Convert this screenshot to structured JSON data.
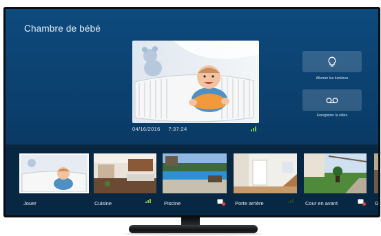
{
  "screen": {
    "room_title": "Chambre de bébé",
    "timestamp_date": "04/16/2016",
    "timestamp_time": "7:37:24",
    "actions": [
      {
        "label": "Allumer les lumières",
        "icon": "lightbulb-icon"
      },
      {
        "label": "Enregistrer la vidéo",
        "icon": "voicemail-icon"
      }
    ]
  },
  "cameras": [
    {
      "label": "Jouer",
      "icon": "none"
    },
    {
      "label": "Cuisine",
      "icon": "signal-icon"
    },
    {
      "label": "Piscine",
      "icon": "clip-icon"
    },
    {
      "label": "Porte arrière",
      "icon": "signal-icon"
    },
    {
      "label": "Cour en avant",
      "icon": "clip-icon"
    },
    {
      "label": "Ga",
      "icon": "none"
    }
  ],
  "colors": {
    "screen_blue": "#0b3f6d",
    "strip_navy": "#072742",
    "signal_green": "#7ec845",
    "selected_border": "#ffffff"
  }
}
